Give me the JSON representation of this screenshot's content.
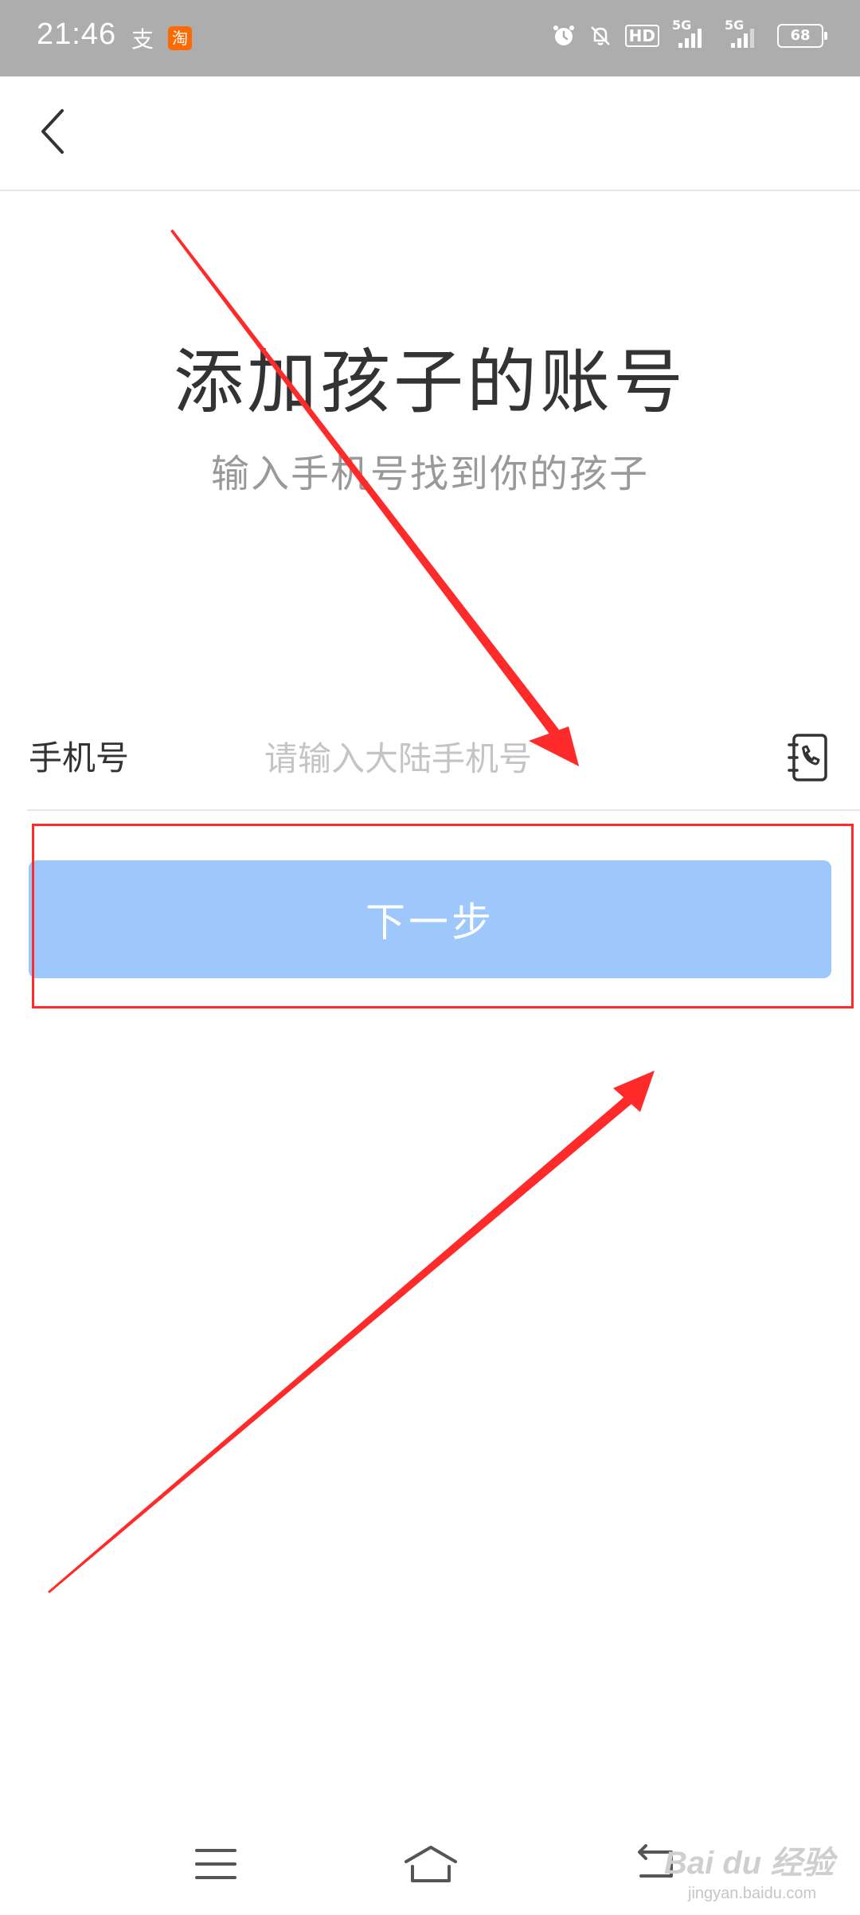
{
  "status_bar": {
    "time": "21:46",
    "alipay_glyph": "支",
    "taobao_glyph": "淘",
    "hd_label": "HD",
    "signal1_label": "5G",
    "signal2_label": "5G",
    "battery_level": "68"
  },
  "header": {
    "title": "添加孩子的账号",
    "subtitle": "输入手机号找到你的孩子"
  },
  "form": {
    "phone_label": "手机号",
    "phone_value": "",
    "phone_placeholder": "请输入大陆手机号",
    "next_button_label": "下一步"
  },
  "colors": {
    "status_bar_bg": "#adadad",
    "button_bg": "#9ec8fb",
    "annotation": "#ff2a2a",
    "placeholder": "#c4c4c4"
  },
  "watermark": {
    "logo_text": "Bai du 经验",
    "url_text": "jingyan.baidu.com"
  },
  "icons": {
    "back": "chevron-left-icon",
    "contacts": "contact-book-icon",
    "menu": "menu-icon",
    "home": "home-icon",
    "back_nav": "back-icon"
  }
}
